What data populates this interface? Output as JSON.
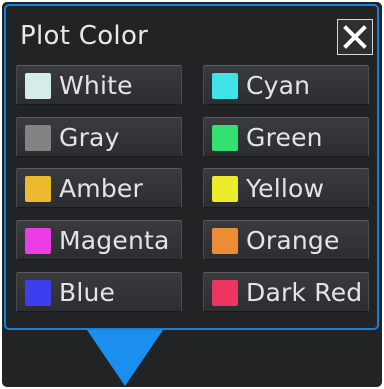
{
  "dialog": {
    "title": "Plot Color",
    "close_label": "✕",
    "accent_color": "#1a7fd6",
    "background_color": "#222325"
  },
  "colors": [
    {
      "label": "White",
      "swatch": "#d6ecea"
    },
    {
      "label": "Cyan",
      "swatch": "#3fe3e8"
    },
    {
      "label": "Gray",
      "swatch": "#838383"
    },
    {
      "label": "Green",
      "swatch": "#33e070"
    },
    {
      "label": "Amber",
      "swatch": "#ecba2e"
    },
    {
      "label": "Yellow",
      "swatch": "#ecec2b"
    },
    {
      "label": "Magenta",
      "swatch": "#ec3ce4"
    },
    {
      "label": "Orange",
      "swatch": "#ec8c35"
    },
    {
      "label": "Blue",
      "swatch": "#3c3ef0"
    },
    {
      "label": "Dark Red",
      "swatch": "#ec3560"
    }
  ]
}
